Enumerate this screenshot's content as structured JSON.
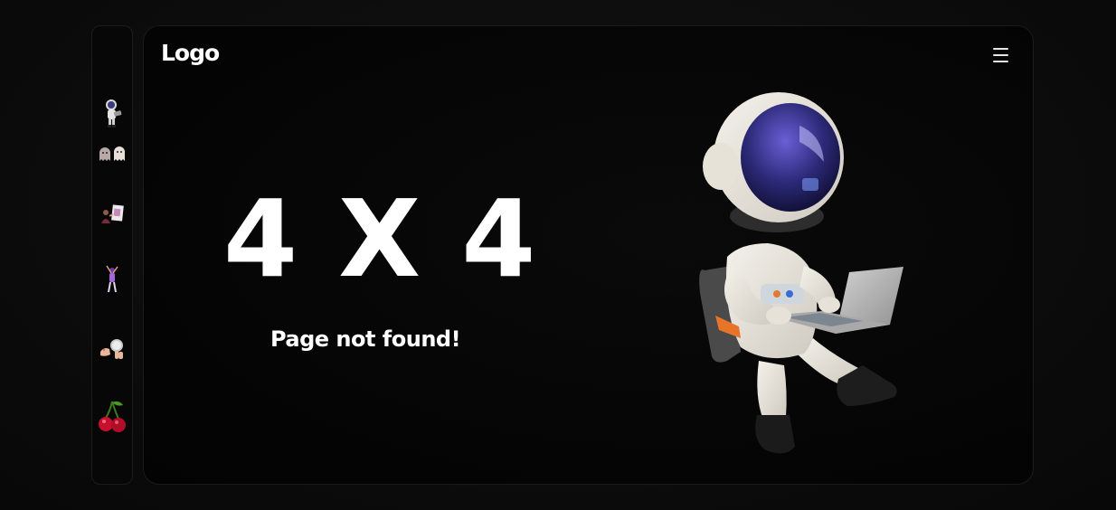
{
  "header": {
    "logo_text": "Logo",
    "menu_icon": "hamburger-menu-icon"
  },
  "sidebar": {
    "items": [
      {
        "icon": "astronaut-sticker-icon"
      },
      {
        "icon": "ghosts-sticker-icon"
      },
      {
        "icon": "painter-sticker-icon"
      },
      {
        "icon": "dancer-sticker-icon"
      },
      {
        "icon": "magnifier-hand-sticker-icon"
      },
      {
        "icon": "cherries-sticker-icon"
      }
    ]
  },
  "main": {
    "headline": "4 X 4",
    "subtitle": "Page not found!",
    "illustration": "astronaut-with-laptop-illustration"
  },
  "colors": {
    "background": "#0d0d0d",
    "card": "#050505",
    "text": "#ffffff"
  }
}
